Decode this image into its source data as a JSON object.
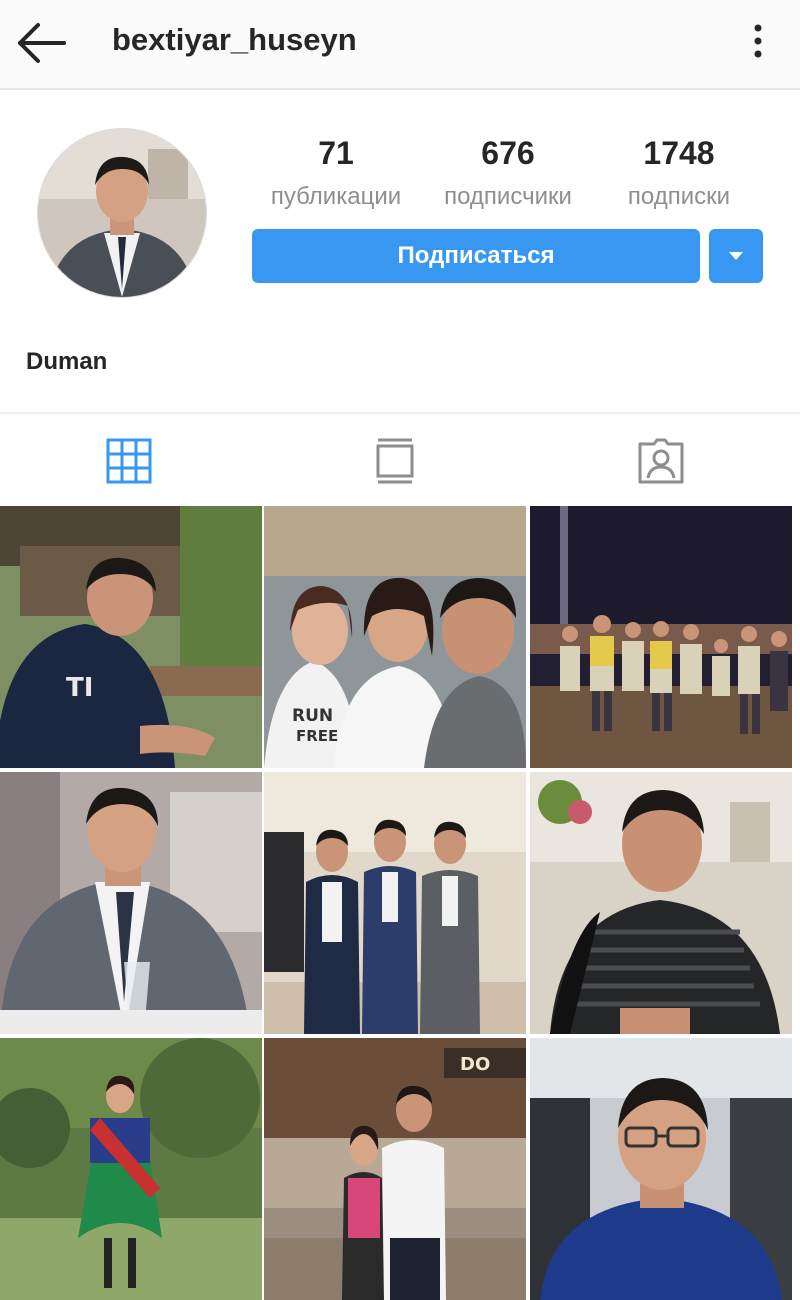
{
  "header": {
    "username": "bextiyar_huseyn",
    "back_icon": "arrow-left-icon",
    "more_icon": "more-vertical-icon"
  },
  "profile": {
    "full_name": "Duman",
    "stats": {
      "posts": {
        "value": "71",
        "label": "публикации"
      },
      "followers": {
        "value": "676",
        "label": "подписчики"
      },
      "following": {
        "value": "1748",
        "label": "подписки"
      }
    },
    "follow_button": "Подписаться",
    "dropdown_icon": "caret-down-icon"
  },
  "tabs": [
    {
      "name": "grid",
      "icon": "grid-icon",
      "active": true
    },
    {
      "name": "feed",
      "icon": "feed-icon",
      "active": false
    },
    {
      "name": "tagged",
      "icon": "tagged-user-icon",
      "active": false
    }
  ],
  "colors": {
    "accent": "#3897f0",
    "active_tab": "#3897f0",
    "inactive_tab": "#8e8e8e",
    "text": "#262626",
    "muted": "#8e8e8e"
  },
  "posts": [
    {
      "id": 1,
      "scene": "man in navy t-shirt at outdoor cafe",
      "overlay_text": "TI"
    },
    {
      "id": 2,
      "scene": "selfie with two girls",
      "overlay_text": "RUN FREE"
    },
    {
      "id": 3,
      "scene": "group photo at night by the sea"
    },
    {
      "id": 4,
      "scene": "man in grey suit at restaurant table"
    },
    {
      "id": 5,
      "scene": "three men in suits indoors"
    },
    {
      "id": 6,
      "scene": "man in striped shirt at cafe"
    },
    {
      "id": 7,
      "scene": "girl in costume with flag in park"
    },
    {
      "id": 8,
      "scene": "man and girl at shopping mall",
      "overlay_text": "DO"
    },
    {
      "id": 9,
      "scene": "man selfie in car"
    }
  ]
}
